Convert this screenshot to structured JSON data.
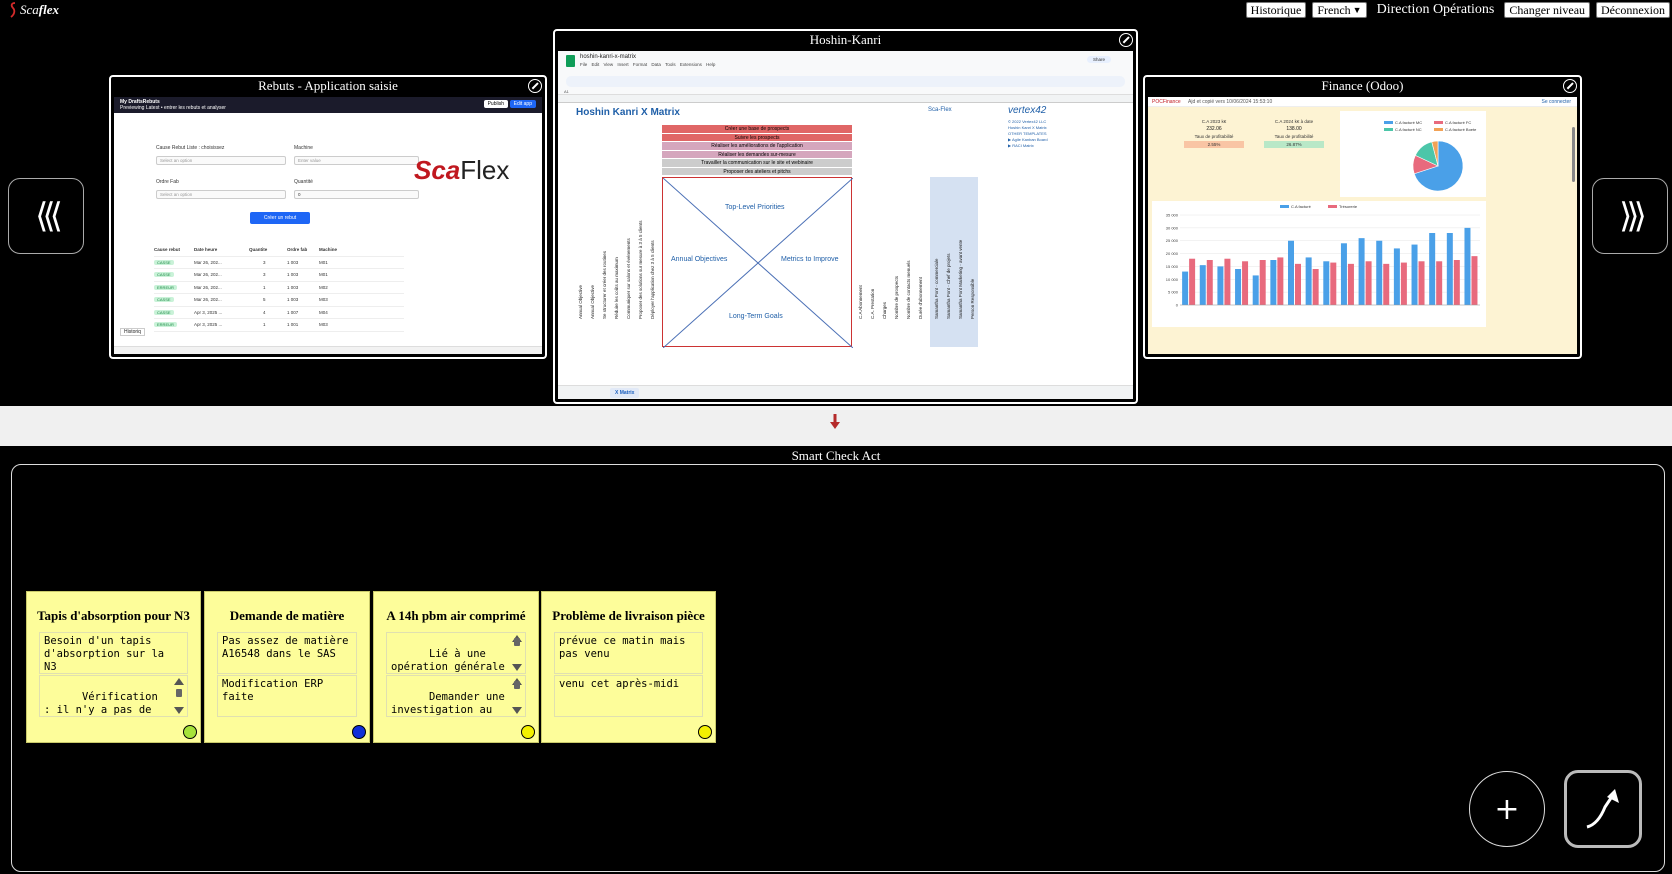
{
  "header": {
    "logo_text_a": "Sca",
    "logo_text_b": "flex",
    "history_label": "Historique",
    "language_selected": "French",
    "direction_label": "Direction Opérations",
    "change_level_label": "Changer niveau",
    "logout_label": "Déconnexion"
  },
  "carousel": {
    "prev_label": "⟨⟨⟨",
    "next_label": "⟩⟩⟩",
    "panels": [
      {
        "title": "Rebuts - Application saisie",
        "app": {
          "header_title": "My DraftsRebuts",
          "header_sub": "Previewing  Latest  • entrer les rebuts et analyser",
          "publish": "Publish",
          "edit_app": "Edit app",
          "cause_label": "Cause Rebut Liste : choisissez",
          "cause_placeholder": "Select an option",
          "machine_label": "Machine",
          "machine_placeholder": "Enter value",
          "ordre_label": "Ordre Fab",
          "ordre_placeholder": "Select an option",
          "qty_label": "Quantité",
          "qty_value": "0",
          "create_button": "Créer un rebut",
          "logo_a": "Sca",
          "logo_b": "Flex",
          "history": "Historiq",
          "table_headers": [
            "Cause rebut",
            "Date heure",
            "Quantite",
            "Ordre fab",
            "Machine"
          ],
          "table_rows": [
            [
              "CASSE",
              "Mar 26, 202...",
              "3",
              "1 003",
              "M01"
            ],
            [
              "CASSE",
              "Mar 26, 202...",
              "3",
              "1 003",
              "M01"
            ],
            [
              "ERREUR",
              "Mar 26, 202...",
              "1",
              "1 003",
              "M02"
            ],
            [
              "CASSE",
              "Mar 26, 202...",
              "5",
              "1 003",
              "M03"
            ],
            [
              "CASSE",
              "Apr 3, 2025 ...",
              "4",
              "1 007",
              "M04"
            ],
            [
              "ERREUR",
              "Apr 3, 2025 ...",
              "1",
              "1 001",
              "M03"
            ]
          ]
        }
      },
      {
        "title": "Hoshin-Kanri",
        "sheet": {
          "file_name": "hoshin-kanri-x-matrix",
          "menu": "File  Edit  View  Insert  Format  Data  Tools  Extensions  Help",
          "share": "Share",
          "cell_ref": "A1",
          "matrix_title": "Hoshin Kanri X Matrix",
          "brand": "Sca-Flex",
          "vertex": "vertex42",
          "side_links": [
            "© 2022 Vertex42 LLC",
            "Hoshin Kanri X Matrix",
            "",
            "OTHER TEMPLATES",
            "▶ Agile Kanban Board",
            "▶ RACI Matrix"
          ],
          "priorities": [
            "Créer une base de prospects",
            "Suivre les prospects",
            "Réaliser les améliorations de l'application",
            "Réaliser les demandes sur-mesure",
            "Travailler la communication sur le site et webinaire",
            "Proposer des ateliers et pitchs"
          ],
          "quadrants": {
            "top": "Top-Level Priorities",
            "left": "Annual Objectives",
            "right": "Metrics to Improve",
            "bottom": "Long-Term Goals"
          },
          "left_columns": [
            "Annual Objective",
            "Annual Objective",
            "Se structurer et créer des routines",
            "Réduire les coûts au maximum",
            "Communiquer sur salons et événements",
            "Proposer des solutions sur mesure à 3 à 5 clients",
            "Déployer l'application chez 3 à 5 clients"
          ],
          "right_columns": [
            "C.A Abonnement",
            "C.A. Prestation",
            "Charges",
            "Nombre de prospects",
            "Nombre de contacts menuels",
            "Durée d'abonnement"
          ],
          "blue_columns": [
            "Samantha Pont - commerciale",
            "Samantha Pont - Chef de projets",
            "Samantha Pont Marketing - avant vente",
            "Person Responsible"
          ],
          "sheet_tab": "X Matrix"
        }
      },
      {
        "title": "Finance (Odoo)",
        "finance": {
          "brand": "POCFinance",
          "note": "Ajd et copié vers 10/06/2024 15:53:10",
          "connect": "Se connecter",
          "kpis": [
            {
              "label": "C.A 2023 k€",
              "value": "232.06",
              "sub": "Taux de profitabilité",
              "box": "2.55%",
              "color": "#f9c5a4"
            },
            {
              "label": "C.A 2024 k€ à date",
              "value": "138.00",
              "sub": "Taux de profitabilité",
              "box": "26.87%",
              "color": "#b9e8c7"
            }
          ],
          "pie_legend": [
            "C.A facturé MC",
            "C.A facturé FC",
            "C.A facturé NC",
            "C.A facturé Boete"
          ],
          "bar_legend": [
            "C.A facturé",
            "Trésorerie"
          ],
          "y_ticks": [
            "35 000",
            "30 000",
            "25 000",
            "20 000",
            "15 000",
            "10 000",
            "5 000",
            "0"
          ]
        }
      }
    ]
  },
  "chart_data": [
    {
      "type": "pie",
      "title": "",
      "labels": [
        "C.A facturé MC",
        "C.A facturé FC",
        "C.A facturé NC",
        "C.A facturé Boete"
      ],
      "values": [
        70,
        12,
        14,
        4
      ],
      "colors": [
        "#4aa0e8",
        "#e86a7d",
        "#4cc6a9",
        "#f2a256"
      ]
    },
    {
      "type": "bar",
      "title": "",
      "ylim": [
        0,
        35000
      ],
      "series": [
        {
          "name": "C.A facturé",
          "color": "#4aa0e8",
          "values": [
            13000,
            15500,
            15000,
            14000,
            11500,
            17500,
            25000,
            18500,
            17000,
            24000,
            26000,
            25000,
            22000,
            23500,
            28000,
            28000,
            30000
          ]
        },
        {
          "name": "Trésorerie",
          "color": "#e86a7d",
          "values": [
            18000,
            17500,
            18000,
            17000,
            17500,
            18500,
            16000,
            14000,
            16500,
            16000,
            17000,
            16000,
            16500,
            17000,
            17000,
            17500,
            19000
          ]
        }
      ]
    }
  ],
  "separator": {
    "arrow": "↓"
  },
  "smart_check_act": {
    "title": "Smart Check Act",
    "cards": [
      {
        "title": "Tapis d'absorption pour N3",
        "field1": "Besoin d'un tapis d'absorption sur la N3",
        "field2": "Vérification : il n'y a pas de tapis => à commander",
        "status_color": "#a6e23a",
        "f1_scroll": false,
        "f2_scroll": true
      },
      {
        "title": "Demande de matière",
        "field1": "Pas assez de matière A16548 dans le SAS",
        "field2": "Modification ERP faite",
        "status_color": "#1030d8",
        "f1_scroll": false,
        "f2_scroll": false
      },
      {
        "title": "A 14h pbm air comprimé",
        "field1": "Lié à une opération générale sans doute, air comprimé en",
        "field2": "Demander une investigation au responsable",
        "status_color": "#f3f000",
        "f1_scroll": true,
        "f2_scroll": true
      },
      {
        "title": "Problème de livraison pièce",
        "field1": "prévue ce matin mais pas venu",
        "field2": "venu cet après-midi",
        "status_color": "#f3f000",
        "f1_scroll": false,
        "f2_scroll": false
      }
    ],
    "add_label": "+"
  }
}
